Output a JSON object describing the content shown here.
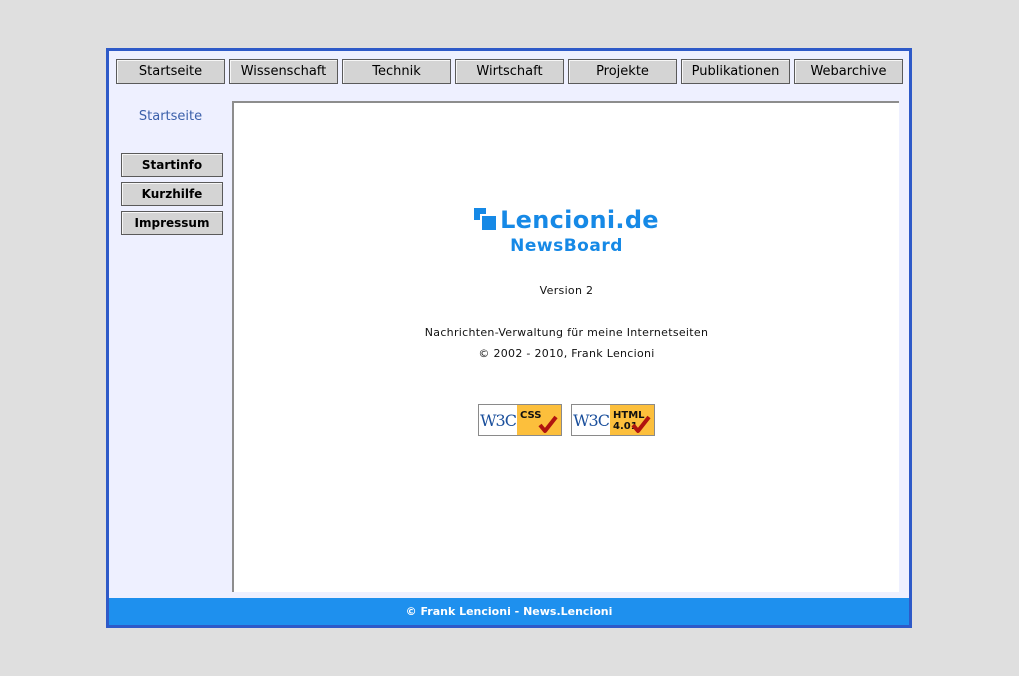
{
  "topnav": {
    "items": [
      {
        "label": "Startseite"
      },
      {
        "label": "Wissenschaft"
      },
      {
        "label": "Technik"
      },
      {
        "label": "Wirtschaft"
      },
      {
        "label": "Projekte"
      },
      {
        "label": "Publikationen"
      },
      {
        "label": "Webarchive"
      }
    ]
  },
  "sidebar": {
    "title": "Startseite",
    "items": [
      {
        "label": "Startinfo"
      },
      {
        "label": "Kurzhilfe"
      },
      {
        "label": "Impressum"
      }
    ]
  },
  "main": {
    "logo_text": "Lencioni.de",
    "logo_icon": "overlapping-squares-icon",
    "logo_subtitle": "NewsBoard",
    "version": "Version 2",
    "description": "Nachrichten-Verwaltung für meine Internetseiten",
    "copyright": "© 2002 - 2010, Frank Lencioni",
    "badges": [
      {
        "logo": "W3C",
        "label": "CSS",
        "icon": "checkmark-icon"
      },
      {
        "logo": "W3C",
        "label": "HTML 4.01",
        "icon": "checkmark-icon"
      }
    ]
  },
  "footer": {
    "text": "© Frank Lencioni - News.Lencioni"
  },
  "colors": {
    "frame_border": "#2e5ac8",
    "brand_blue": "#1689e6",
    "footer_bg": "#1e90ee",
    "page_bg": "#dfdfdf",
    "sidebar_bg": "#eef0ff",
    "badge_accent": "#fcbf3c"
  }
}
